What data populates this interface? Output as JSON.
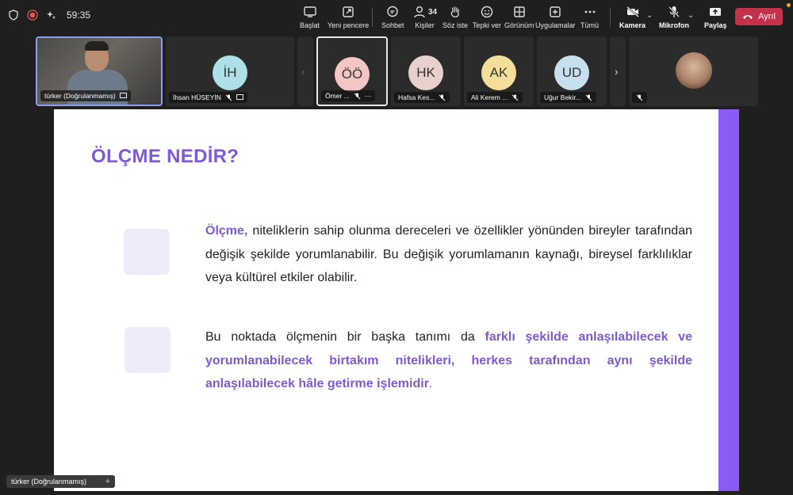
{
  "timer": "59:35",
  "toolbar": {
    "items": [
      {
        "label": "Başlat"
      },
      {
        "label": "Yeni pencere"
      },
      {
        "label": "Sohbet"
      },
      {
        "label": "Kişiler",
        "count": "34"
      },
      {
        "label": "Söz iste"
      },
      {
        "label": "Tepki ver"
      },
      {
        "label": "Görünüm"
      },
      {
        "label": "Uygulamalar"
      },
      {
        "label": "Tümü"
      },
      {
        "label": "Kamera"
      },
      {
        "label": "Mikrofon"
      },
      {
        "label": "Paylaş"
      }
    ],
    "leave_label": "Ayrıl"
  },
  "participants": [
    {
      "name": "türker (Doğrulanmamış)",
      "type": "video"
    },
    {
      "name": "İhsan HÜSEYİN",
      "initials": "İH",
      "color": "#aee0e8"
    },
    {
      "name": "Ömer ...",
      "initials": "ÖÖ",
      "color": "#f3c6c4"
    },
    {
      "name": "Hafsa Kes...",
      "initials": "HK",
      "color": "#e8d0cc"
    },
    {
      "name": "Ali Kerem ...",
      "initials": "AK",
      "color": "#f4df9a"
    },
    {
      "name": "Uğur Bekir...",
      "initials": "UD",
      "color": "#c6e0f0"
    },
    {
      "name": "",
      "type": "photo"
    }
  ],
  "slide": {
    "title": "ÖLÇME NEDİR?",
    "p1_accent": "Ölçme,",
    "p1_text": " niteliklerin sahip olunma dereceleri ve özellikler yönünden bireyler tarafından değişik şekilde yorumlanabilir. Bu değişik yorumlamanın kaynağı, bireysel farklılıklar veya kültürel etkiler olabilir.",
    "p2_text": "Bu noktada ölçmenin bir başka tanımı da ",
    "p2_accent": " farklı şekilde anlaşılabilecek ve yorumlanabilecek birtakım nitelikleri, herkes tarafından aynı şekilde anlaşılabilecek hâle getirme işlemidir",
    "p2_end": "."
  },
  "self_view_label": "türker (Doğrulanmamış)",
  "colors": {
    "accent": "#7b5bd6",
    "band": "#8a5cf5",
    "leave": "#c4314b"
  }
}
